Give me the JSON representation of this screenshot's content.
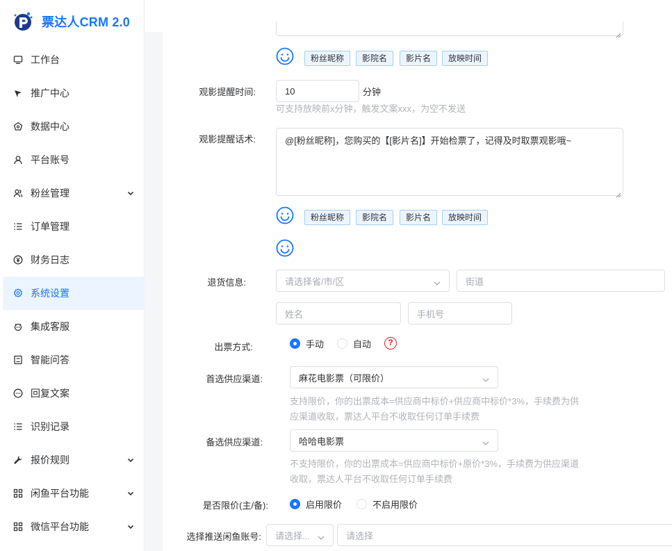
{
  "app": {
    "title": "票达人CRM 2.0",
    "brand_color": "#1677ff"
  },
  "sidebar": {
    "items": [
      {
        "label": "工作台",
        "icon": "monitor-icon",
        "expandable": false
      },
      {
        "label": "推广中心",
        "icon": "send-icon",
        "expandable": false
      },
      {
        "label": "数据中心",
        "icon": "dashboard-icon",
        "expandable": false
      },
      {
        "label": "平台账号",
        "icon": "user-icon",
        "expandable": false
      },
      {
        "label": "粉丝管理",
        "icon": "users-icon",
        "expandable": true
      },
      {
        "label": "订单管理",
        "icon": "list-icon",
        "expandable": false
      },
      {
        "label": "财务日志",
        "icon": "yen-icon",
        "expandable": false
      },
      {
        "label": "系统设置",
        "icon": "gear-icon",
        "expandable": false,
        "active": true
      },
      {
        "label": "集成客服",
        "icon": "service-icon",
        "expandable": false
      },
      {
        "label": "智能问答",
        "icon": "qa-icon",
        "expandable": false
      },
      {
        "label": "回复文案",
        "icon": "chat-icon",
        "expandable": false
      },
      {
        "label": "识别记录",
        "icon": "list-icon",
        "expandable": false
      },
      {
        "label": "报价规则",
        "icon": "wrench-icon",
        "expandable": true
      },
      {
        "label": "闲鱼平台功能",
        "icon": "grid-icon",
        "expandable": true
      },
      {
        "label": "微信平台功能",
        "icon": "grid-icon",
        "expandable": true
      }
    ]
  },
  "form": {
    "tags_1": [
      "粉丝昵称",
      "影院名",
      "影片名",
      "放映时间"
    ],
    "reminder_time": {
      "label": "观影提醒时间:",
      "value": "10",
      "unit": "分钟",
      "hint": "可支持放映前x分钟，触发文案xxx，为空不发送"
    },
    "reminder_text": {
      "label": "观影提醒话术:",
      "value": "@[粉丝昵称]，您购买的【[影片名]】开始检票了，记得及时取票观影哦~"
    },
    "tags_2": [
      "粉丝昵称",
      "影院名",
      "影片名",
      "放映时间"
    ],
    "return_info": {
      "label": "退货信息:",
      "region_placeholder": "请选择省/市/区",
      "street_placeholder": "街道",
      "name_placeholder": "姓名",
      "phone_placeholder": "手机号"
    },
    "ticket_method": {
      "label": "出票方式:",
      "options": [
        "手动",
        "自动"
      ],
      "selected": "手动",
      "help": "?"
    },
    "primary_channel": {
      "label": "首选供应渠道:",
      "value": "麻花电影票（可限价）",
      "hint_line1": "支持限价，你的出票成本=供应商中标价+供应商中标价*3%，手续费为供",
      "hint_line2": "应渠道收取，票达人平台不收取任何订单手续费"
    },
    "backup_channel": {
      "label": "备选供应渠道:",
      "value": "哈哈电影票",
      "hint_line1": "不支持限价，你的出票成本=供应商中标价+原价*3%，手续费为供应渠道",
      "hint_line2": "收取，票达人平台不收取任何订单手续费"
    },
    "price_limit": {
      "label": "是否限价(主/备):",
      "options": [
        "启用限价",
        "不启用限价"
      ],
      "selected": "启用限价"
    },
    "xianyu_account": {
      "label": "选择推送闲鱼账号:",
      "select_placeholder": "请选择...",
      "input_placeholder": "请选择"
    }
  }
}
